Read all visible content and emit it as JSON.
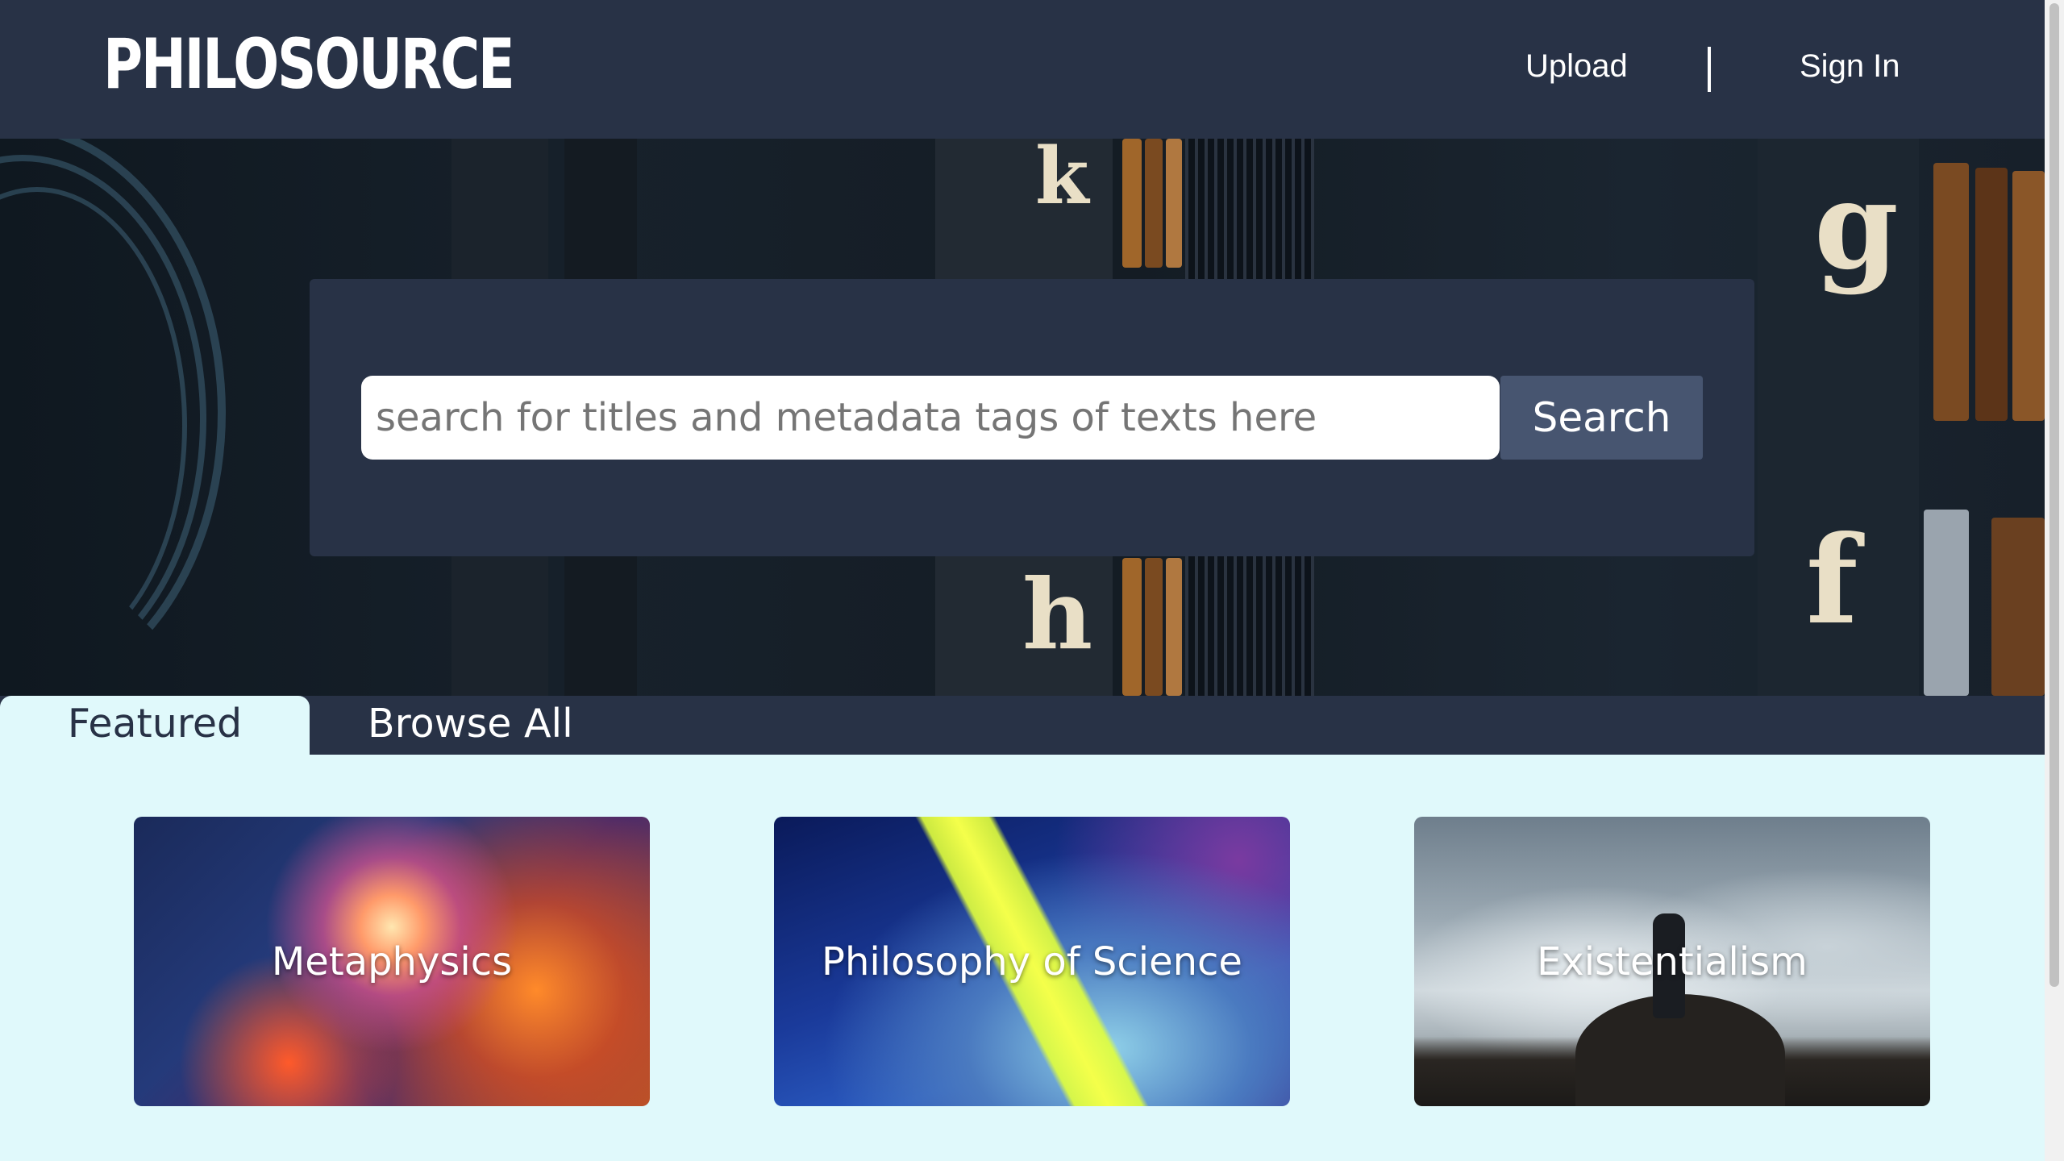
{
  "header": {
    "logo": "PHILOSOURCE",
    "nav": {
      "upload_label": "Upload",
      "signin_label": "Sign In"
    }
  },
  "hero": {
    "background_letters": [
      "k",
      "g",
      "h",
      "f"
    ]
  },
  "search": {
    "placeholder": "search for titles and metadata tags of texts here",
    "value": "",
    "button_label": "Search"
  },
  "tabs": [
    {
      "label": "Featured",
      "active": true
    },
    {
      "label": "Browse All",
      "active": false
    }
  ],
  "featured_cards": [
    {
      "label": "Metaphysics"
    },
    {
      "label": "Philosophy of Science"
    },
    {
      "label": "Existentialism"
    }
  ],
  "colors": {
    "header_bg": "#283246",
    "page_bg": "#e0f9fb",
    "search_button_bg": "#475570",
    "text_light": "#ffffff"
  }
}
